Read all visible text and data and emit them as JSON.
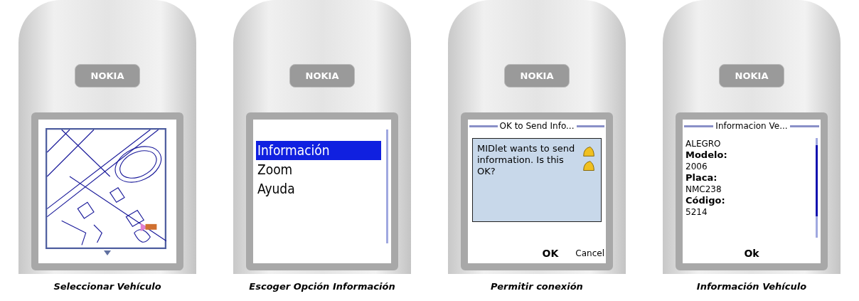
{
  "phones": [
    {
      "brand": "NOKIA",
      "caption": "Seleccionar Vehículo",
      "screen": {
        "kind": "map"
      }
    },
    {
      "brand": "NOKIA",
      "caption": "Escoger Opción Información",
      "screen": {
        "kind": "menu",
        "items": [
          {
            "label": "Información",
            "selected": true
          },
          {
            "label": "Zoom",
            "selected": false
          },
          {
            "label": "Ayuda",
            "selected": false
          }
        ]
      }
    },
    {
      "brand": "NOKIA",
      "caption": "Permitir conexión",
      "screen": {
        "kind": "alert",
        "title": "OK to Send Info...",
        "message": "MIDlet wants to send information. Is this OK?",
        "softkeys": [
          "OK",
          "Cancel"
        ]
      }
    },
    {
      "brand": "NOKIA",
      "caption": "Información Vehículo",
      "screen": {
        "kind": "form",
        "title": "Informacion Ve...",
        "fields": [
          {
            "value": "ALEGRO"
          },
          {
            "label": "Modelo:",
            "value": "2006"
          },
          {
            "label": "Placa:",
            "value": "NMC238"
          },
          {
            "label": "Código:",
            "value": "5214"
          }
        ],
        "softkeys": [
          "Ok"
        ]
      }
    }
  ]
}
